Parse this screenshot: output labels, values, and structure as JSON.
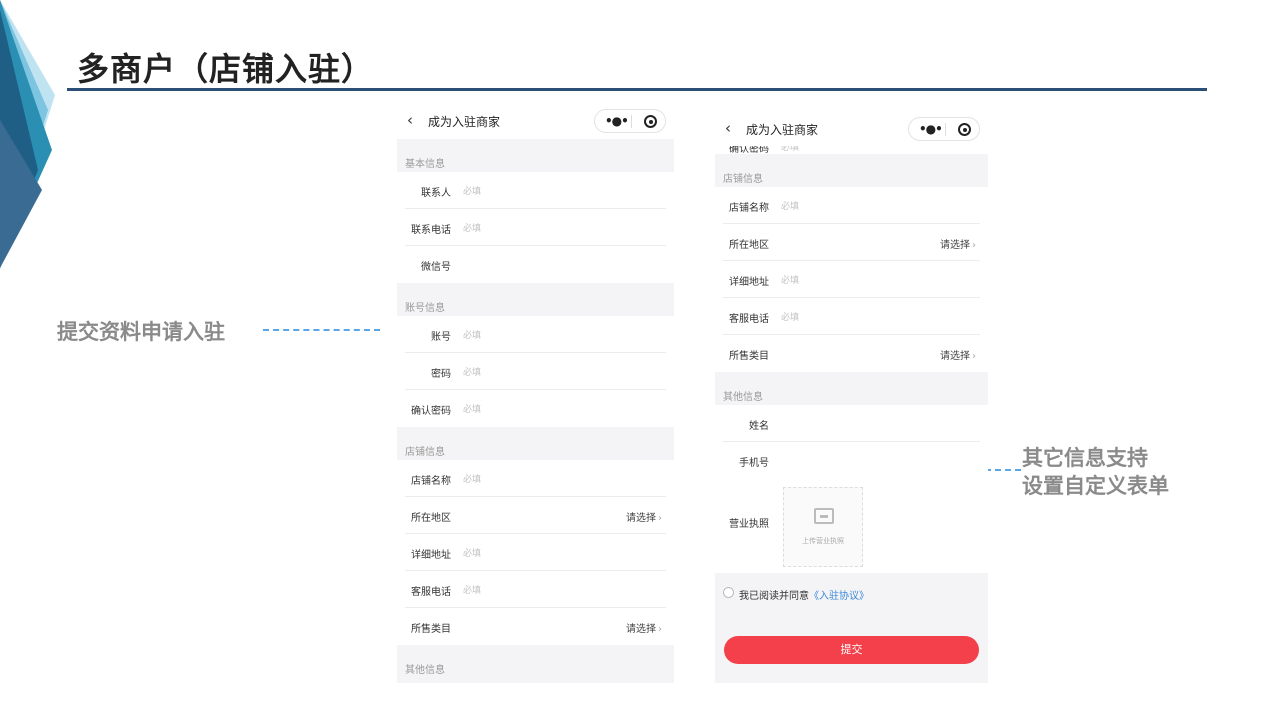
{
  "slide": {
    "title": "多商户（店铺入驻）",
    "callout_left": "提交资料申请入驻",
    "callout_right_line1": "其它信息支持",
    "callout_right_line2": "设置自定义表单"
  },
  "colors": {
    "title_line": "#2c4f78",
    "dash": "#5aa6e6",
    "submit": "#f4404a",
    "link": "#3a88d8"
  },
  "phone1": {
    "nav_title": "成为入驻商家",
    "sections": [
      {
        "head": "基本信息",
        "rows": [
          {
            "label": "联系人",
            "ph": "必填"
          },
          {
            "label": "联系电话",
            "ph": "必填"
          },
          {
            "label": "微信号",
            "ph": ""
          }
        ]
      },
      {
        "head": "账号信息",
        "rows": [
          {
            "label": "账号",
            "ph": "必填"
          },
          {
            "label": "密码",
            "ph": "必填"
          },
          {
            "label": "确认密码",
            "ph": "必填"
          }
        ]
      },
      {
        "head": "店铺信息",
        "rows": [
          {
            "label": "店铺名称",
            "ph": "必填"
          },
          {
            "label": "所在地区",
            "select": "请选择"
          },
          {
            "label": "详细地址",
            "ph": "必填"
          },
          {
            "label": "客服电话",
            "ph": "必填"
          },
          {
            "label": "所售类目",
            "select": "请选择"
          }
        ]
      },
      {
        "head": "其他信息",
        "rows": []
      }
    ]
  },
  "phone2": {
    "nav_title": "成为入驻商家",
    "cut_label": "确认密码",
    "cut_ph": "必填",
    "store_head": "店铺信息",
    "store_rows": [
      {
        "label": "店铺名称",
        "ph": "必填"
      },
      {
        "label": "所在地区",
        "select": "请选择"
      },
      {
        "label": "详细地址",
        "ph": "必填"
      },
      {
        "label": "客服电话",
        "ph": "必填"
      },
      {
        "label": "所售类目",
        "select": "请选择"
      }
    ],
    "other_head": "其他信息",
    "other_rows": [
      {
        "label": "姓名",
        "ph": ""
      },
      {
        "label": "手机号",
        "ph": ""
      }
    ],
    "upload_label": "营业执照",
    "upload_text": "上传营业执照",
    "agree_text": "我已阅读并同意",
    "agree_link": "《入驻协议》",
    "submit": "提交"
  },
  "icons": {
    "back": "chevron-left-icon",
    "more": "more-dots-icon",
    "close": "target-circle-icon",
    "chevron": "chevron-right-icon",
    "upload": "image-upload-icon"
  }
}
